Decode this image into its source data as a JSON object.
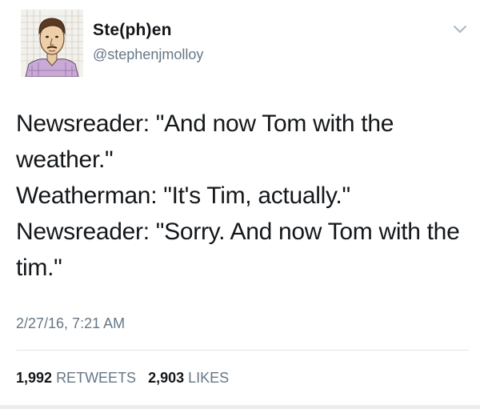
{
  "user": {
    "display_name": "Ste(ph)en",
    "handle": "@stephenjmolloy",
    "avatar_icon": "avatar-sketch-portrait"
  },
  "tweet": {
    "lines": [
      "Newsreader: \"And now Tom with the weather.\"",
      "Weatherman: \"It's Tim, actually.\"",
      "Newsreader: \"Sorry. And now Tom with the tim.\""
    ],
    "timestamp": "2/27/16, 7:21 AM"
  },
  "stats": {
    "retweets_count": "1,992",
    "retweets_label": "RETWEETS",
    "likes_count": "2,903",
    "likes_label": "LIKES"
  },
  "menu_icon": "chevron-down-icon",
  "colors": {
    "text": "#14171a",
    "secondary": "#657786",
    "divider": "#e1e8ed"
  }
}
